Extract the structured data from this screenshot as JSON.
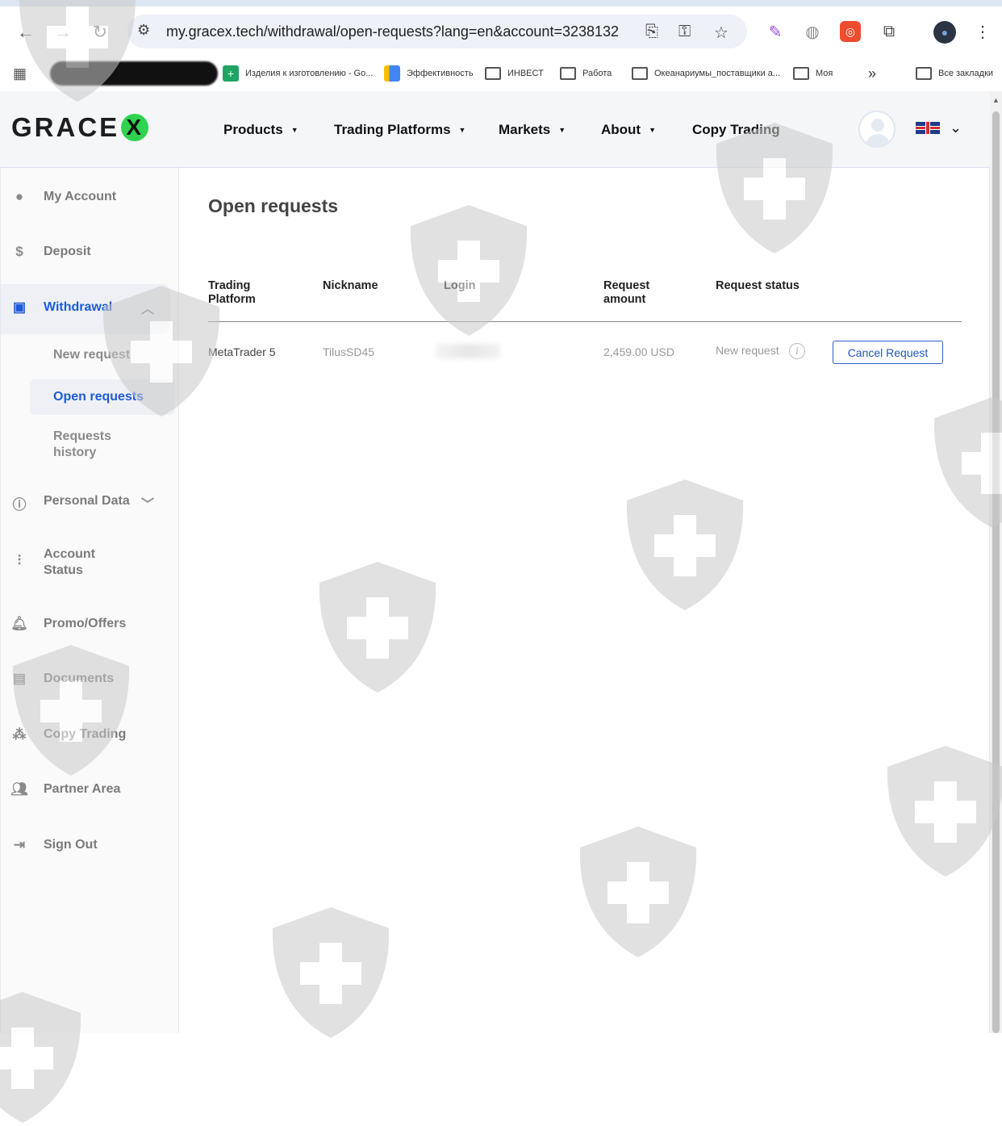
{
  "browser": {
    "url": "my.gracex.tech/withdrawal/open-requests?lang=en&account=3238132",
    "bookmarks": [
      {
        "label": "Изделия к изготовлению - Go..."
      },
      {
        "label": "Эффективность"
      },
      {
        "label": "ИНВЕСТ"
      },
      {
        "label": "Работа"
      },
      {
        "label": "Океанариумы_поставщики а..."
      },
      {
        "label": "Моя"
      }
    ],
    "all_bookmarks": "Все закладки",
    "overflow": "»"
  },
  "header": {
    "logo_text": "GRACE",
    "logo_x": "X",
    "nav": [
      "Products",
      "Trading Platforms",
      "Markets",
      "About",
      "Copy Trading"
    ]
  },
  "sidebar": {
    "items": [
      {
        "label": "My Account",
        "icon": "user-circle-icon"
      },
      {
        "label": "Deposit",
        "icon": "deposit-icon"
      },
      {
        "label": "Withdrawal",
        "icon": "withdrawal-icon"
      },
      {
        "label": "Personal Data",
        "icon": "info-icon"
      },
      {
        "label": "Account Status",
        "icon": "sliders-icon"
      },
      {
        "label": "Promo/Offers",
        "icon": "bell-icon"
      },
      {
        "label": "Documents",
        "icon": "document-icon"
      },
      {
        "label": "Copy Trading",
        "icon": "copy-trading-icon"
      },
      {
        "label": "Partner Area",
        "icon": "users-icon"
      },
      {
        "label": "Sign Out",
        "icon": "sign-out-icon"
      }
    ],
    "withdrawal_sub": [
      {
        "label": "New request"
      },
      {
        "label": "Open requests"
      },
      {
        "label": "Requests history"
      }
    ]
  },
  "main": {
    "title": "Open requests",
    "columns": [
      "Trading Platform",
      "Nickname",
      "Login",
      "Request amount",
      "Request status"
    ],
    "rows": [
      {
        "platform": "MetaTrader 5",
        "nickname": "TilusSD45",
        "amount": "2,459.00 USD",
        "status": "New request",
        "action": "Cancel Request"
      }
    ]
  },
  "colors": {
    "accent": "#1e5bd8",
    "logo_green": "#2fd34f"
  }
}
